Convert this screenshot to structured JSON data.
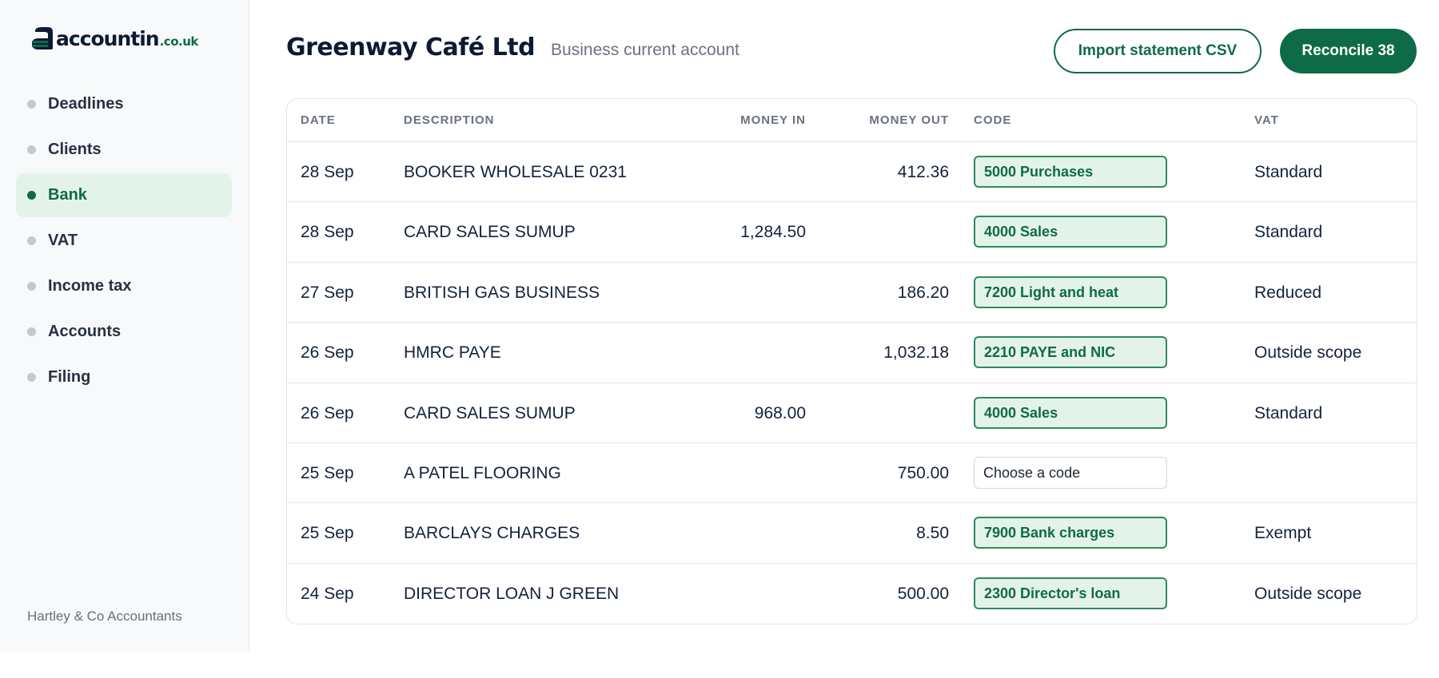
{
  "brand": {
    "name": "accountin",
    "tld": ".co.uk",
    "mark_color": "#0e6b47"
  },
  "sidebar": {
    "items": [
      {
        "label": "Deadlines",
        "active": false
      },
      {
        "label": "Clients",
        "active": false
      },
      {
        "label": "Bank",
        "active": true
      },
      {
        "label": "VAT",
        "active": false
      },
      {
        "label": "Income tax",
        "active": false
      },
      {
        "label": "Accounts",
        "active": false
      },
      {
        "label": "Filing",
        "active": false
      }
    ],
    "footer": "Hartley & Co Accountants"
  },
  "header": {
    "company": "Greenway Café Ltd",
    "account": "Business current account",
    "import_label": "Import statement CSV",
    "reconcile_label": "Reconcile 38"
  },
  "table": {
    "columns": {
      "date": "DATE",
      "description": "DESCRIPTION",
      "money_in": "MONEY IN",
      "money_out": "MONEY OUT",
      "code": "CODE",
      "vat": "VAT"
    },
    "rows": [
      {
        "date": "28 Sep",
        "description": "BOOKER WHOLESALE 0231",
        "money_in": "",
        "money_out": "412.36",
        "code": "5000 Purchases",
        "coded": true,
        "vat": "Standard"
      },
      {
        "date": "28 Sep",
        "description": "CARD SALES SUMUP",
        "money_in": "1,284.50",
        "money_out": "",
        "code": "4000 Sales",
        "coded": true,
        "vat": "Standard"
      },
      {
        "date": "27 Sep",
        "description": "BRITISH GAS BUSINESS",
        "money_in": "",
        "money_out": "186.20",
        "code": "7200 Light and heat",
        "coded": true,
        "vat": "Reduced"
      },
      {
        "date": "26 Sep",
        "description": "HMRC PAYE",
        "money_in": "",
        "money_out": "1,032.18",
        "code": "2210 PAYE and NIC",
        "coded": true,
        "vat": "Outside scope"
      },
      {
        "date": "26 Sep",
        "description": "CARD SALES SUMUP",
        "money_in": "968.00",
        "money_out": "",
        "code": "4000 Sales",
        "coded": true,
        "vat": "Standard"
      },
      {
        "date": "25 Sep",
        "description": "A PATEL FLOORING",
        "money_in": "",
        "money_out": "750.00",
        "code": "Choose a code",
        "coded": false,
        "vat": ""
      },
      {
        "date": "25 Sep",
        "description": "BARCLAYS CHARGES",
        "money_in": "",
        "money_out": "8.50",
        "code": "7900 Bank charges",
        "coded": true,
        "vat": "Exempt"
      },
      {
        "date": "24 Sep",
        "description": "DIRECTOR LOAN J GREEN",
        "money_in": "",
        "money_out": "500.00",
        "code": "2300 Director's loan",
        "coded": true,
        "vat": "Outside scope"
      }
    ]
  }
}
